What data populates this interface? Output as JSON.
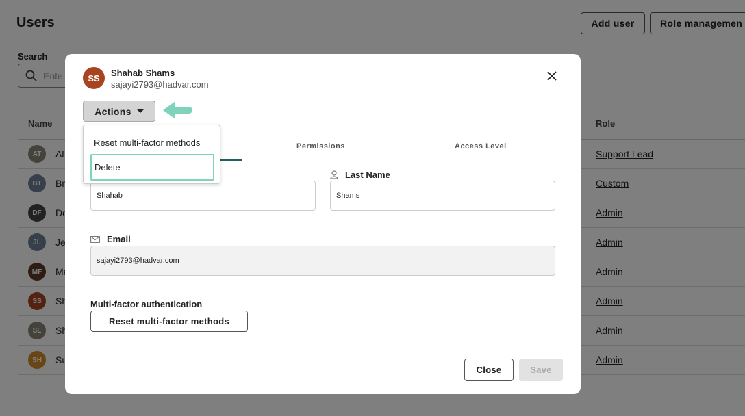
{
  "page": {
    "title": "Users",
    "add_user_label": "Add user",
    "role_mgmt_label": "Role managemen",
    "search_label": "Search",
    "search_placeholder": "Ente",
    "columns": {
      "name": "Name",
      "role": "Role"
    },
    "users": [
      {
        "initials": "AT",
        "name": "Al",
        "role": "Support Lead",
        "color": "#8a8478"
      },
      {
        "initials": "BT",
        "name": "Br",
        "role": "Custom",
        "color": "#6f7f94"
      },
      {
        "initials": "DF",
        "name": "Do",
        "role": "Admin",
        "color": "#444444"
      },
      {
        "initials": "JL",
        "name": "Je",
        "role": "Admin",
        "color": "#6f7f94"
      },
      {
        "initials": "MF",
        "name": "Ma",
        "role": "Admin",
        "color": "#5b3a2a"
      },
      {
        "initials": "SS",
        "name": "Sh",
        "role": "Admin",
        "color": "#a94420"
      },
      {
        "initials": "SL",
        "name": "Sh",
        "role": "Admin",
        "color": "#8a8478"
      },
      {
        "initials": "SH",
        "name": "Su",
        "role": "Admin",
        "color": "#d08a2a"
      }
    ]
  },
  "modal": {
    "avatar_initials": "SS",
    "user_name": "Shahab Shams",
    "user_email": "sajayi2793@hadvar.com",
    "actions_label": "Actions",
    "dropdown": {
      "reset_label": "Reset multi-factor methods",
      "delete_label": "Delete"
    },
    "tabs": {
      "permissions": "Permissions",
      "access_level": "Access Level"
    },
    "first_name_value": "Shahab",
    "last_name_label": "Last Name",
    "last_name_value": "Shams",
    "email_label": "Email",
    "email_value": "sajayi2793@hadvar.com",
    "mfa_label": "Multi-factor authentication",
    "mfa_button_label": "Reset multi-factor methods",
    "close_label": "Close",
    "save_label": "Save"
  },
  "colors": {
    "overlay": "rgba(0,0,0,0.5)",
    "accent_teal": "#7fd3bc",
    "tab_underline": "#1f5f66"
  }
}
